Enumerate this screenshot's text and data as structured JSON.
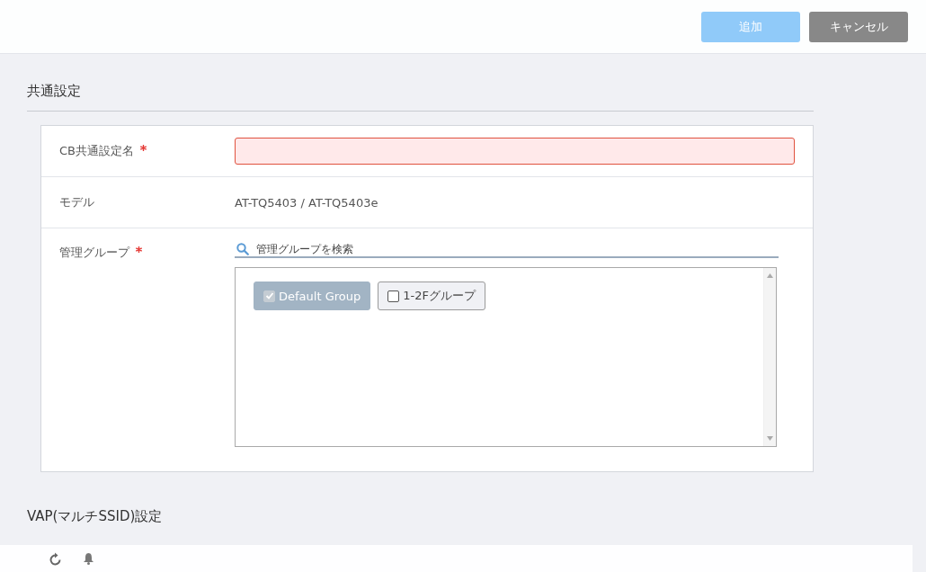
{
  "header": {
    "buttons": [
      {
        "label": "追加",
        "kind": "primary",
        "disabled": true
      },
      {
        "label": "キャンセル",
        "kind": "secondary",
        "disabled": false
      }
    ]
  },
  "sections": [
    {
      "title": "共通設定",
      "fields": [
        {
          "kind": "input",
          "label": "CB共通設定名",
          "required": true,
          "invalid": true
        },
        {
          "kind": "text",
          "label": "モデル",
          "required": false,
          "value": "AT-TQ5403 / AT-TQ5403e"
        },
        {
          "kind": "groups",
          "label": "管理グループ",
          "required": true,
          "placeholder": "管理グループを検索",
          "groups": [
            {
              "label": "Default Group",
              "checked": true,
              "disabled": true
            },
            {
              "label": "1-2Fグループ",
              "checked": false,
              "disabled": false
            }
          ]
        }
      ]
    },
    {
      "title": "VAP(マルチSSID)設定"
    }
  ]
}
